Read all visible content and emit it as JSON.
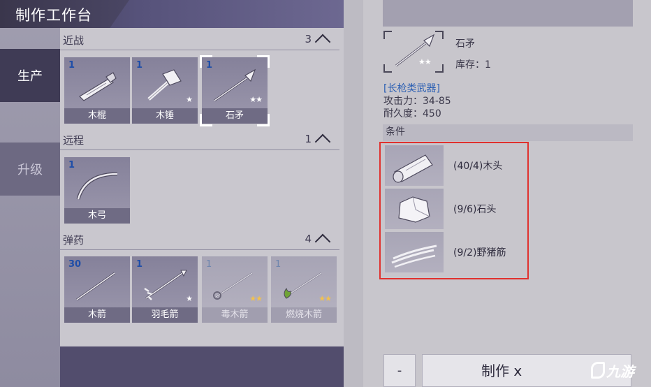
{
  "title": "制作工作台",
  "nav": {
    "produce": "生产",
    "upgrade": "升级"
  },
  "sections": {
    "melee": {
      "title": "近战",
      "count": "3",
      "items": [
        {
          "qty": "1",
          "name": "木棍",
          "stars": ""
        },
        {
          "qty": "1",
          "name": "木锤",
          "stars": "★"
        },
        {
          "qty": "1",
          "name": "石矛",
          "stars": "★★"
        }
      ]
    },
    "ranged": {
      "title": "远程",
      "count": "1",
      "items": [
        {
          "qty": "1",
          "name": "木弓",
          "stars": ""
        }
      ]
    },
    "ammo": {
      "title": "弹药",
      "count": "4",
      "items": [
        {
          "qty": "30",
          "name": "木箭",
          "stars": ""
        },
        {
          "qty": "1",
          "name": "羽毛箭",
          "stars": "★"
        },
        {
          "qty": "1",
          "name": "毒木箭",
          "stars": "★★"
        },
        {
          "qty": "1",
          "name": "燃烧木箭",
          "stars": "★★"
        }
      ]
    }
  },
  "detail": {
    "item_name": "石矛",
    "stock": "库存：1",
    "stars": "★★",
    "category": "[长枪类武器]",
    "attack": "攻击力：34-85",
    "durability": "耐久度：450",
    "conditions_title": "条件",
    "materials": [
      {
        "text": "(40/4)木头",
        "icon": "wood-log-icon"
      },
      {
        "text": "(9/6)石头",
        "icon": "stone-icon"
      },
      {
        "text": "(9/2)野猪筋",
        "icon": "boar-tendon-icon"
      }
    ]
  },
  "buttons": {
    "minus": "-",
    "craft": "制作 x"
  },
  "watermark": "九游",
  "colors": {
    "quantity": "#1f4ea8",
    "highlight_box": "#e0312e",
    "category_link": "#2b5fb3",
    "star_gold": "#f2c14e"
  }
}
